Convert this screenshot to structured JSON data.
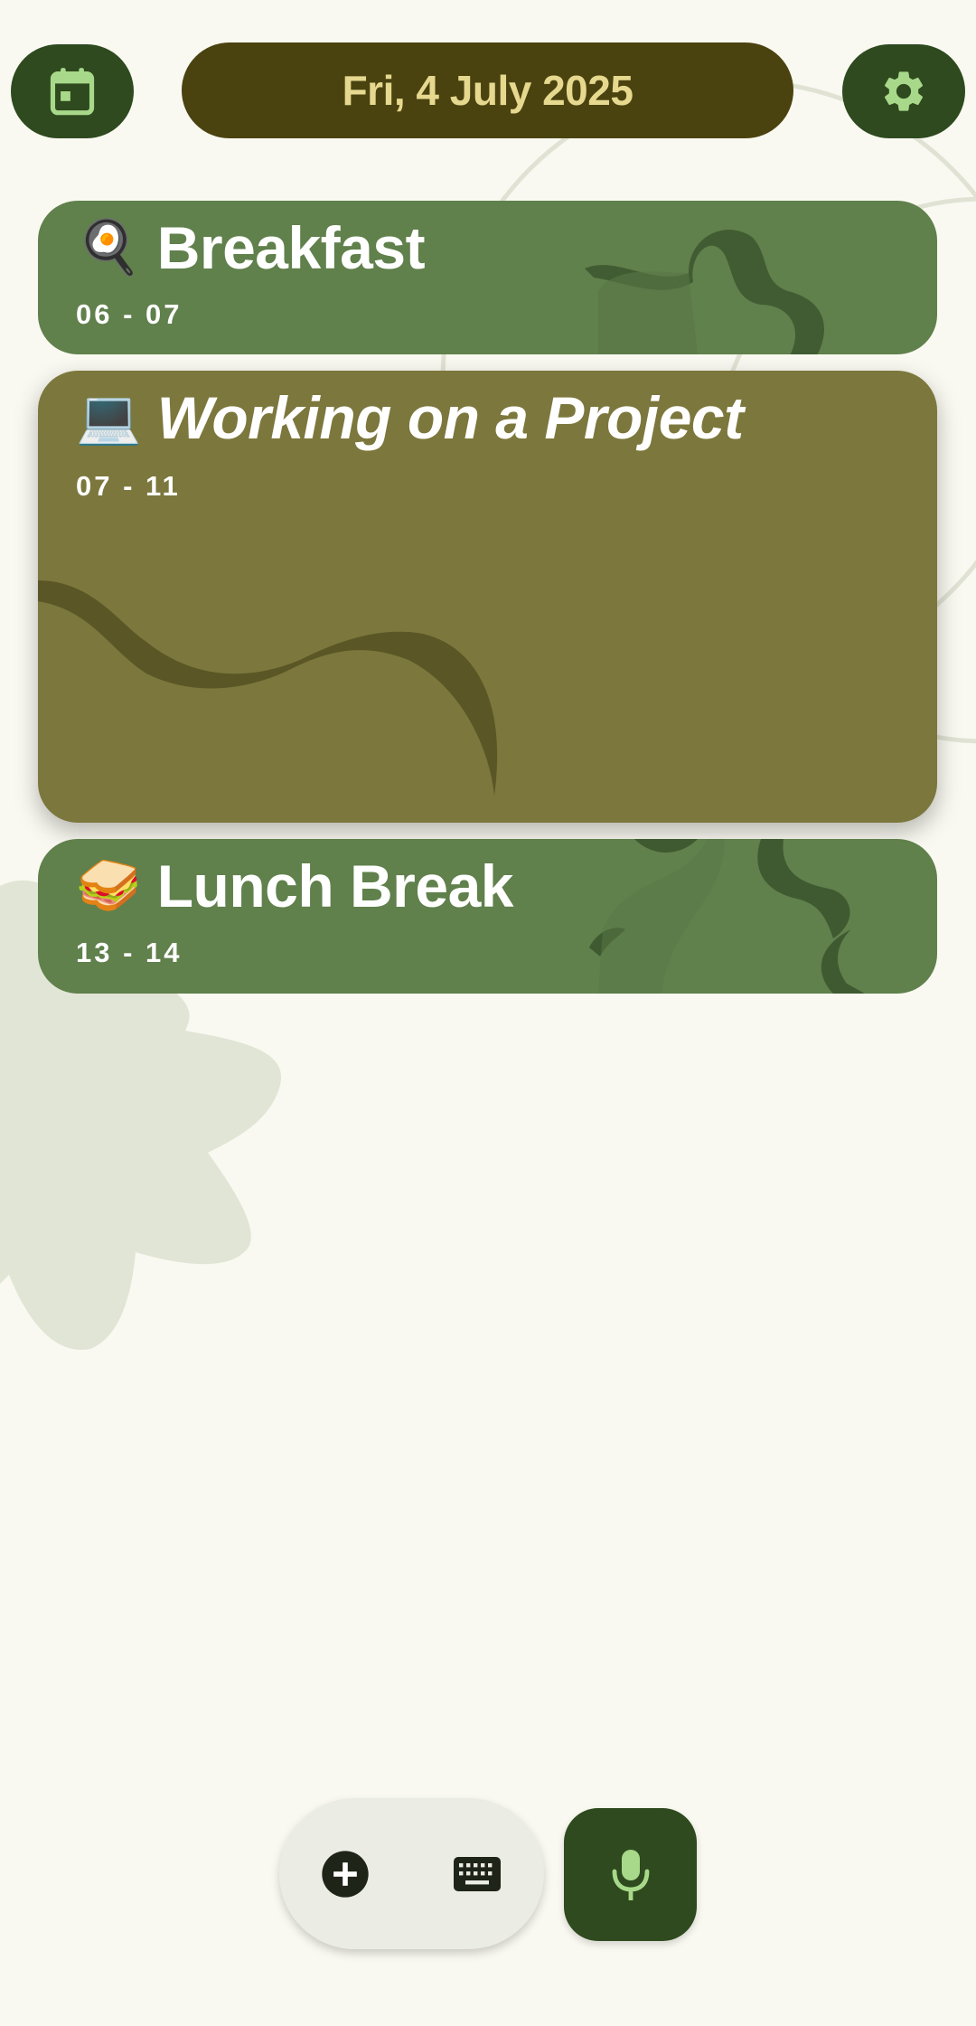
{
  "header": {
    "date": "Fri, 4 July 2025",
    "calendar_icon": "calendar-icon",
    "settings_icon": "gear-icon"
  },
  "events": [
    {
      "emoji": "🍳",
      "title": "Breakfast",
      "time": "06 - 07",
      "color": "#60804c"
    },
    {
      "emoji": "💻",
      "title": "Working on a Project",
      "time": "07 - 11",
      "color": "#7c773c"
    },
    {
      "emoji": "🥪",
      "title": "Lunch Break",
      "time": "13 - 14",
      "color": "#60804c"
    }
  ],
  "bottom_bar": {
    "add_icon": "add-circle-icon",
    "keyboard_icon": "keyboard-icon",
    "mic_icon": "microphone-icon"
  },
  "colors": {
    "background": "#f9f9f1",
    "accent_dark": "#2e4a1e",
    "date_pill": "#4a4310",
    "date_text": "#e6d98f",
    "icon_tint": "#a8d98a"
  }
}
